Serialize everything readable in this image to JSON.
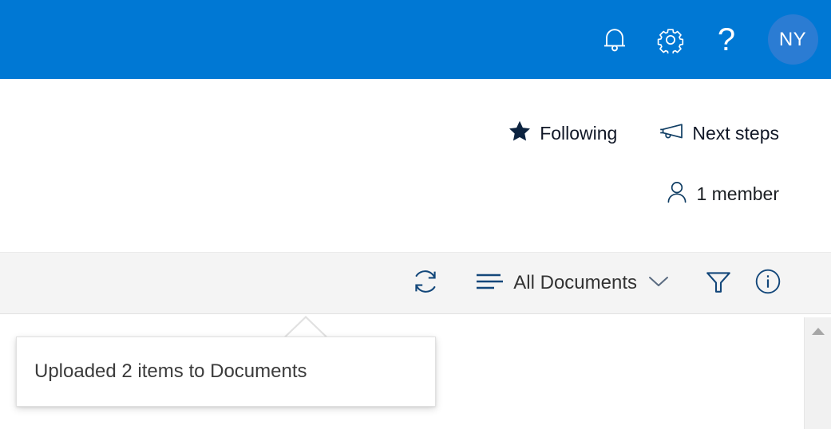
{
  "suite_bar": {
    "background_color": "#0078d4",
    "actions": [
      {
        "name": "notifications",
        "icon": "bell-icon",
        "label": "Notifications"
      },
      {
        "name": "settings",
        "icon": "gear-icon",
        "label": "Settings"
      },
      {
        "name": "help",
        "icon": "question-mark-icon",
        "label": "Help",
        "glyph": "?"
      }
    ],
    "avatar": {
      "initials": "NY",
      "background_color": "#2b7cd3",
      "text_color": "#ffffff"
    }
  },
  "site_header": {
    "following": {
      "label": "Following",
      "icon": "star-icon"
    },
    "next_steps": {
      "label": "Next steps",
      "icon": "megaphone-icon"
    },
    "members": {
      "label": "1 member",
      "icon": "person-icon"
    }
  },
  "toolbar": {
    "background_color": "#f4f4f4",
    "refresh": {
      "label": "Refresh",
      "icon": "refresh-icon"
    },
    "view_selector": {
      "label": "All Documents",
      "list_icon": "list-view-icon",
      "chevron_icon": "chevron-down-icon"
    },
    "filter": {
      "label": "Filter",
      "icon": "filter-funnel-icon"
    },
    "info": {
      "label": "Information",
      "icon": "info-circle-icon"
    }
  },
  "callout": {
    "message": "Uploaded 2 items to Documents"
  },
  "scrollbar": {
    "up_arrow": "scroll-up-arrow-icon"
  }
}
